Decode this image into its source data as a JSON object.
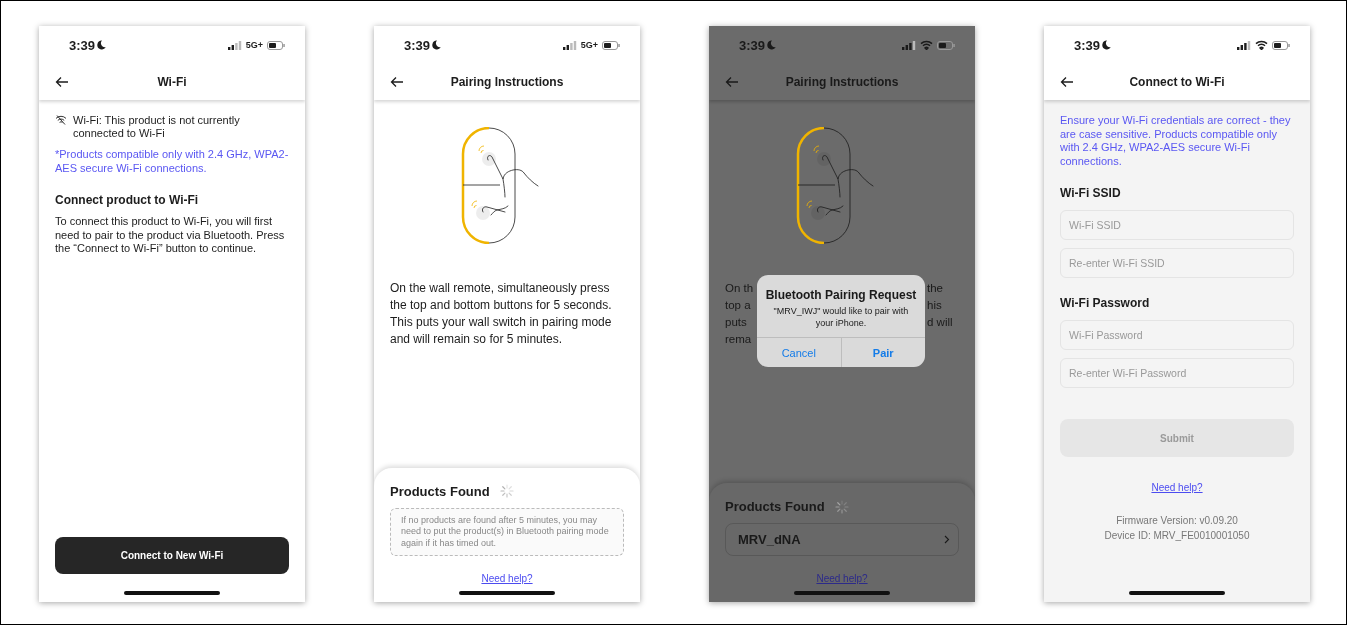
{
  "screens": [
    {
      "kind": "wifi_status",
      "time": "3:39",
      "connection": {
        "kind": "cellular",
        "label": "5G+"
      },
      "dimmed": false,
      "title": "Wi-Fi",
      "notice": "Wi-Fi: This product is not currently connected to Wi-Fi",
      "compat_note": "*Products compatible only with 2.4 GHz, WPA2-AES secure Wi-Fi connections.",
      "heading": "Connect product to Wi-Fi",
      "body": "To connect this product to Wi-Fi, you will first need to pair to the product via Bluetooth. Press the “Connect to Wi-Fi” button to continue.",
      "button": "Connect to New Wi-Fi"
    },
    {
      "kind": "pairing",
      "time": "3:39",
      "connection": {
        "kind": "cellular",
        "label": "5G+"
      },
      "dimmed": false,
      "title": "Pairing Instructions",
      "instructions": "On the wall remote, simultaneously press the top and bottom buttons for 5 seconds. This puts your wall switch in pairing mode and will remain so for 5 minutes.",
      "sheet": {
        "title": "Products Found",
        "hint": "If no products are found after 5 minutes, you may need to put the product(s) in Bluetooth pairing mode again if it has timed out.",
        "help_link": "Need help?"
      }
    },
    {
      "kind": "pairing",
      "time": "3:39",
      "connection": {
        "kind": "wifi"
      },
      "dimmed": true,
      "title": "Pairing Instructions",
      "instructions_left": [
        "On th",
        "top a",
        "puts",
        "rema"
      ],
      "instructions_right": [
        "the",
        "his",
        "d will"
      ],
      "dialog": {
        "title": "Bluetooth Pairing Request",
        "message": "\"MRV_IWJ\" would like to pair with your iPhone.",
        "buttons": [
          {
            "label": "Cancel",
            "default": false
          },
          {
            "label": "Pair",
            "default": true
          }
        ]
      },
      "sheet": {
        "title": "Products Found",
        "products": [
          "MRV_dNA"
        ],
        "help_link": "Need help?"
      }
    },
    {
      "kind": "wifi_form",
      "time": "3:39",
      "connection": {
        "kind": "wifi"
      },
      "dimmed": false,
      "title": "Connect to Wi-Fi",
      "note": "Ensure your Wi-Fi credentials are correct - they are case sensitive. Products compatible only with 2.4 GHz, WPA2-AES secure Wi-Fi connections.",
      "groups": [
        {
          "heading": "Wi-Fi SSID",
          "fields": [
            {
              "placeholder": "Wi-Fi SSID"
            },
            {
              "placeholder": "Re-enter Wi-Fi SSID"
            }
          ]
        },
        {
          "heading": "Wi-Fi Password",
          "fields": [
            {
              "placeholder": "Wi-Fi Password"
            },
            {
              "placeholder": "Re-enter Wi-Fi Password"
            }
          ]
        }
      ],
      "submit": {
        "label": "Submit",
        "disabled": true
      },
      "help_link": "Need help?",
      "firmware": "Firmware Version: v0.09.20",
      "device_id": "Device ID: MRV_FE0010001050"
    }
  ]
}
